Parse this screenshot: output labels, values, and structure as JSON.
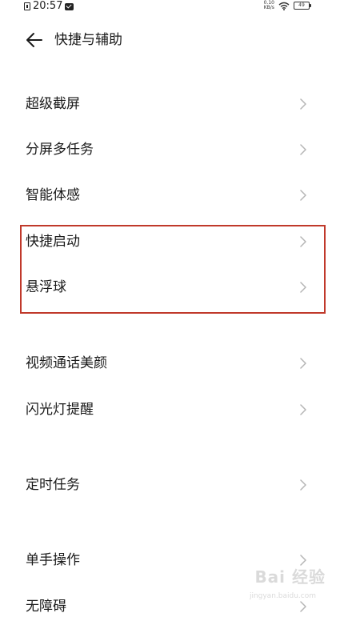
{
  "status_bar": {
    "time": "20:57",
    "speed_value": "0.10",
    "speed_unit": "KB/s",
    "battery": "49"
  },
  "header": {
    "title": "快捷与辅助"
  },
  "settings": {
    "items": [
      {
        "label": "超级截屏"
      },
      {
        "label": "分屏多任务"
      },
      {
        "label": "智能体感"
      },
      {
        "label": "快捷启动"
      },
      {
        "label": "悬浮球"
      },
      {
        "label": "视频通话美颜"
      },
      {
        "label": "闪光灯提醒"
      },
      {
        "label": "定时任务"
      },
      {
        "label": "单手操作"
      },
      {
        "label": "无障碍"
      }
    ]
  },
  "watermark": {
    "brand": "Bai 经验",
    "url": "jingyan.baidu.com"
  },
  "colors": {
    "highlight": "#c0392b",
    "chevron": "#b5b5b5",
    "text": "#1a1a1a"
  },
  "icons": {
    "back": "arrow-left-icon",
    "item": "chevron-right-icon"
  }
}
